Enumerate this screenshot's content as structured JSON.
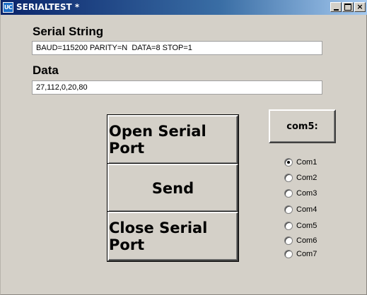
{
  "window": {
    "app_icon_text": "UC",
    "title": "SERIALTEST *",
    "minimize_icon": "minimize-icon",
    "maximize_icon": "maximize-icon",
    "close_icon": "close-icon",
    "close_glyph": "×"
  },
  "serial_string": {
    "label": "Serial String",
    "value": "BAUD=115200 PARITY=N  DATA=8 STOP=1"
  },
  "data_field": {
    "label": "Data",
    "value": "27,112,0,20,80"
  },
  "buttons": {
    "open": "Open Serial Port",
    "send": "Send",
    "close": "Close Serial Port",
    "com": "com5:"
  },
  "com_ports": [
    {
      "label": "Com1",
      "checked": true
    },
    {
      "label": "Com2",
      "checked": false
    },
    {
      "label": "Com3",
      "checked": false
    },
    {
      "label": "Com4",
      "checked": false
    },
    {
      "label": "Com5",
      "checked": false
    },
    {
      "label": "Com6",
      "checked": false
    },
    {
      "label": "Com7",
      "checked": false
    }
  ]
}
